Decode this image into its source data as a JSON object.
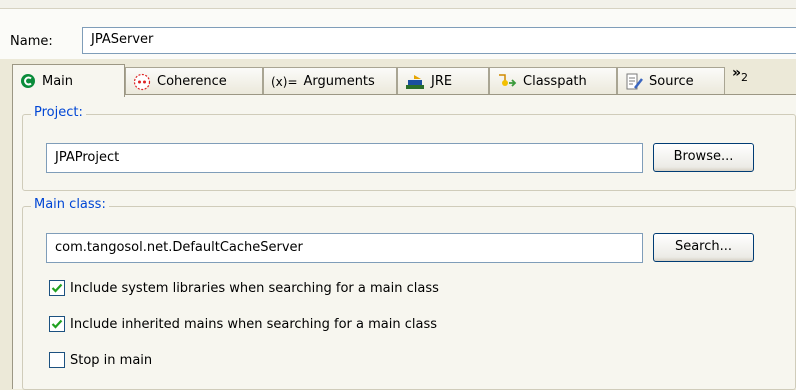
{
  "name": {
    "label": "Name:",
    "value": "JPAServer"
  },
  "tabs": [
    {
      "label": "Main",
      "icon": "main-class-icon",
      "active": true
    },
    {
      "label": "Coherence",
      "icon": "coherence-icon"
    },
    {
      "label": "Arguments",
      "icon": "arguments-icon"
    },
    {
      "label": "JRE",
      "icon": "jre-icon"
    },
    {
      "label": "Classpath",
      "icon": "classpath-icon"
    },
    {
      "label": "Source",
      "icon": "source-icon"
    }
  ],
  "tabs_overflow": {
    "label": "»",
    "count": "2"
  },
  "project": {
    "title": "Project:",
    "value": "JPAProject",
    "button": "Browse..."
  },
  "main_class": {
    "title": "Main class:",
    "value": "com.tangosol.net.DefaultCacheServer",
    "button": "Search..."
  },
  "options": [
    {
      "label": "Include system libraries when searching for a main class",
      "checked": true
    },
    {
      "label": "Include inherited mains when searching for a main class",
      "checked": true
    },
    {
      "label": "Stop in main",
      "checked": false
    }
  ],
  "colors": {
    "group_title": "#0046d5",
    "check": "#21a121",
    "accent": "#0a8c3a"
  }
}
